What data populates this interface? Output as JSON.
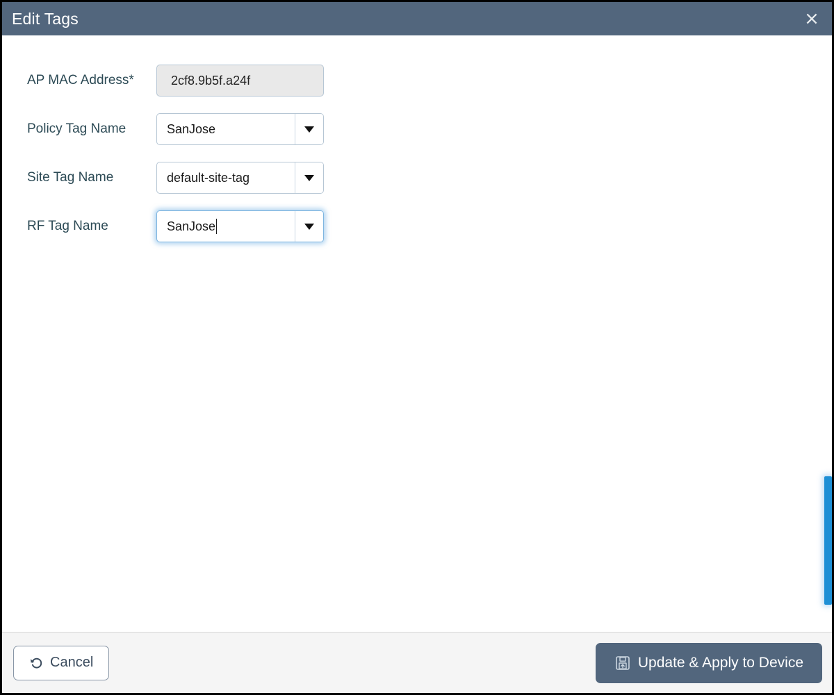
{
  "dialog": {
    "title": "Edit Tags",
    "close_icon": "close-icon"
  },
  "form": {
    "fields": [
      {
        "label": "AP MAC Address*",
        "type": "text",
        "value": "2cf8.9b5f.a24f",
        "placeholder": "",
        "disabled": true,
        "focused": false
      },
      {
        "label": "Policy Tag Name",
        "type": "combo",
        "value": "SanJose",
        "placeholder": "",
        "disabled": false,
        "focused": false,
        "caret_icon": "chevron-down-icon"
      },
      {
        "label": "Site Tag Name",
        "type": "combo",
        "value": "default-site-tag",
        "placeholder": "",
        "disabled": false,
        "focused": false,
        "caret_icon": "chevron-down-icon"
      },
      {
        "label": "RF Tag Name",
        "type": "combo",
        "value": "SanJose",
        "placeholder": "",
        "disabled": false,
        "focused": true,
        "caret_icon": "chevron-down-icon"
      }
    ]
  },
  "footer": {
    "cancel_label": "Cancel",
    "cancel_icon": "undo-icon",
    "submit_label": "Update & Apply to Device",
    "submit_icon": "save-icon"
  },
  "scrollbar": {
    "name": "vertical-scroll-indicator"
  },
  "colors": {
    "header_bg": "#52667d",
    "primary_button_bg": "#52667d",
    "footer_bg": "#f5f5f5",
    "label_text": "#2c4a55",
    "field_border": "#b6c6d4",
    "focus_glow": "#7eb5e0",
    "scroll_indicator": "#1e8fd5",
    "disabled_field_bg": "#e9e9e9"
  }
}
